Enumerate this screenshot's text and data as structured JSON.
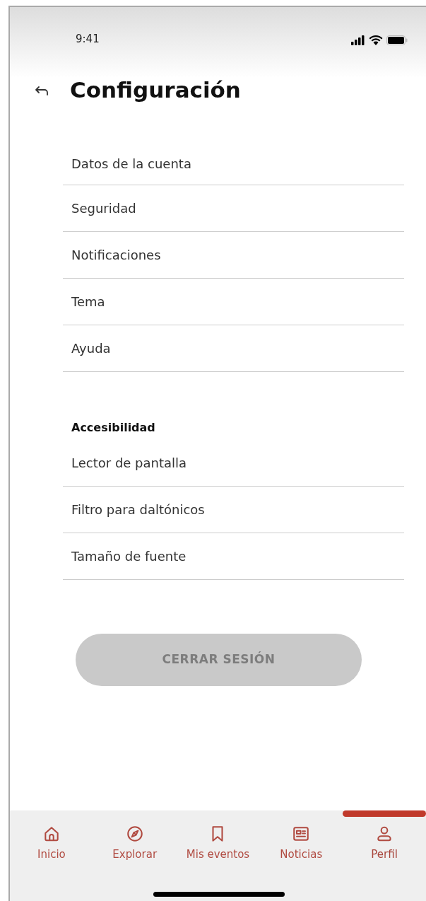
{
  "status_bar": {
    "time": "9:41"
  },
  "header": {
    "title": "Configuración"
  },
  "sections": [
    {
      "items": [
        "Datos de la cuenta",
        "Seguridad",
        "Notificaciones",
        "Tema",
        "Ayuda"
      ]
    },
    {
      "heading": "Accesibilidad",
      "items": [
        "Lector de pantalla",
        "Filtro para daltónicos",
        "Tamaño de fuente"
      ]
    }
  ],
  "logout_button": {
    "label": "CERRAR SESIÓN",
    "disabled": true
  },
  "bottom_nav": [
    {
      "label": "Inicio",
      "selected": false
    },
    {
      "label": "Explorar",
      "selected": false
    },
    {
      "label": "Mis eventos",
      "selected": false
    },
    {
      "label": "Noticias",
      "selected": false
    },
    {
      "label": "Perfil",
      "selected": true
    }
  ]
}
